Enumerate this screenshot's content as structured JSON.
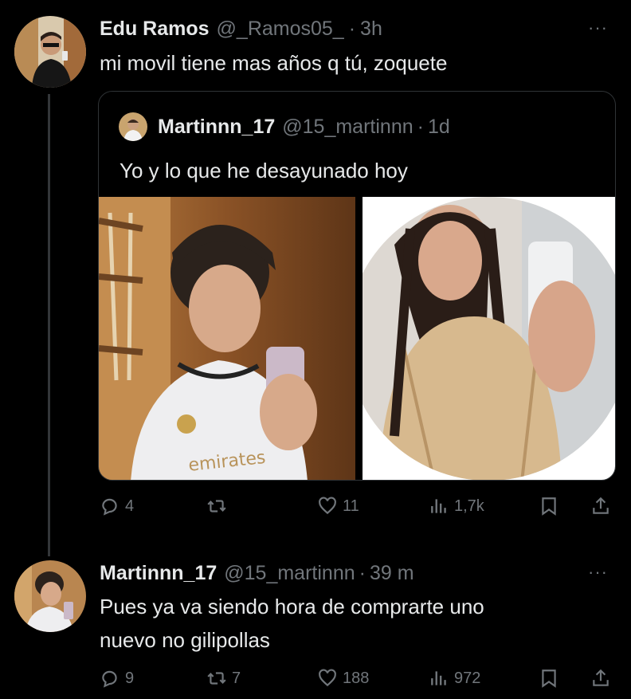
{
  "tweet": {
    "display_name": "Edu Ramos",
    "handle": "@_Ramos05_",
    "dot": "·",
    "time": "3h",
    "more_label": "···",
    "text": "mi movil tiene mas años q tú, zoquete",
    "stats": {
      "replies": "4",
      "reposts": "",
      "likes": "11",
      "views": "1,7k"
    }
  },
  "quoted": {
    "display_name": "Martinnn_17",
    "handle": "@15_martinnn",
    "dot": "·",
    "time": "1d",
    "text": "Yo y lo que he desayunado hoy"
  },
  "reply": {
    "display_name": "Martinnn_17",
    "handle": "@15_martinnn",
    "dot": "·",
    "time": "39 m",
    "more_label": "···",
    "text_line1": "Pues ya va siendo hora de comprarte uno",
    "text_line2": "nuevo no gilipollas",
    "stats": {
      "replies": "9",
      "reposts": "7",
      "likes": "188",
      "views": "972"
    }
  },
  "colors": {
    "background": "#000000",
    "text": "#e7e9ea",
    "muted": "#71767b",
    "border": "#2f3336"
  },
  "icons": [
    "reply-icon",
    "repost-icon",
    "like-icon",
    "views-icon",
    "bookmark-icon",
    "share-icon"
  ]
}
